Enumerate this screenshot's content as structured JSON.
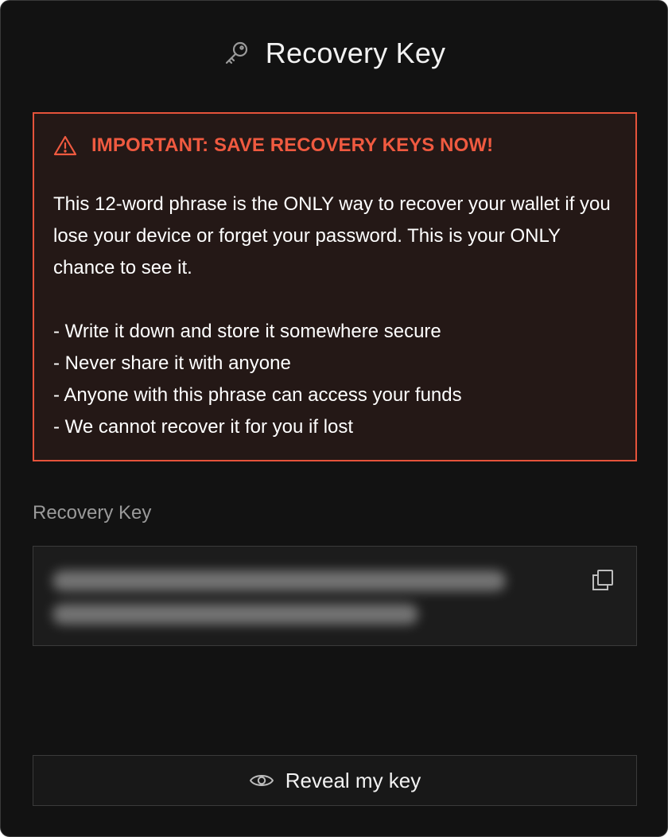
{
  "header": {
    "title": "Recovery Key",
    "icon": "key-icon"
  },
  "warning": {
    "icon": "warning-icon",
    "title": "IMPORTANT: SAVE RECOVERY KEYS NOW!",
    "body": "This 12-word phrase is the ONLY way to recover your wallet if you lose your device or forget your password. This is your ONLY chance to see it.",
    "bullets": [
      "- Write it down and store it somewhere secure",
      "- Never share it with anyone",
      "- Anyone with this phrase can access your funds",
      "- We cannot recover it for you if lost"
    ],
    "colors": {
      "accent": "#e5533b",
      "background": "#241816"
    }
  },
  "recovery_key": {
    "label": "Recovery Key",
    "value": "",
    "hidden": true,
    "copy_icon": "copy-icon"
  },
  "reveal_button": {
    "label": "Reveal my key",
    "icon": "eye-icon"
  },
  "colors": {
    "background": "#121212",
    "text": "#f2f2f2",
    "muted": "#9a9a9a"
  }
}
